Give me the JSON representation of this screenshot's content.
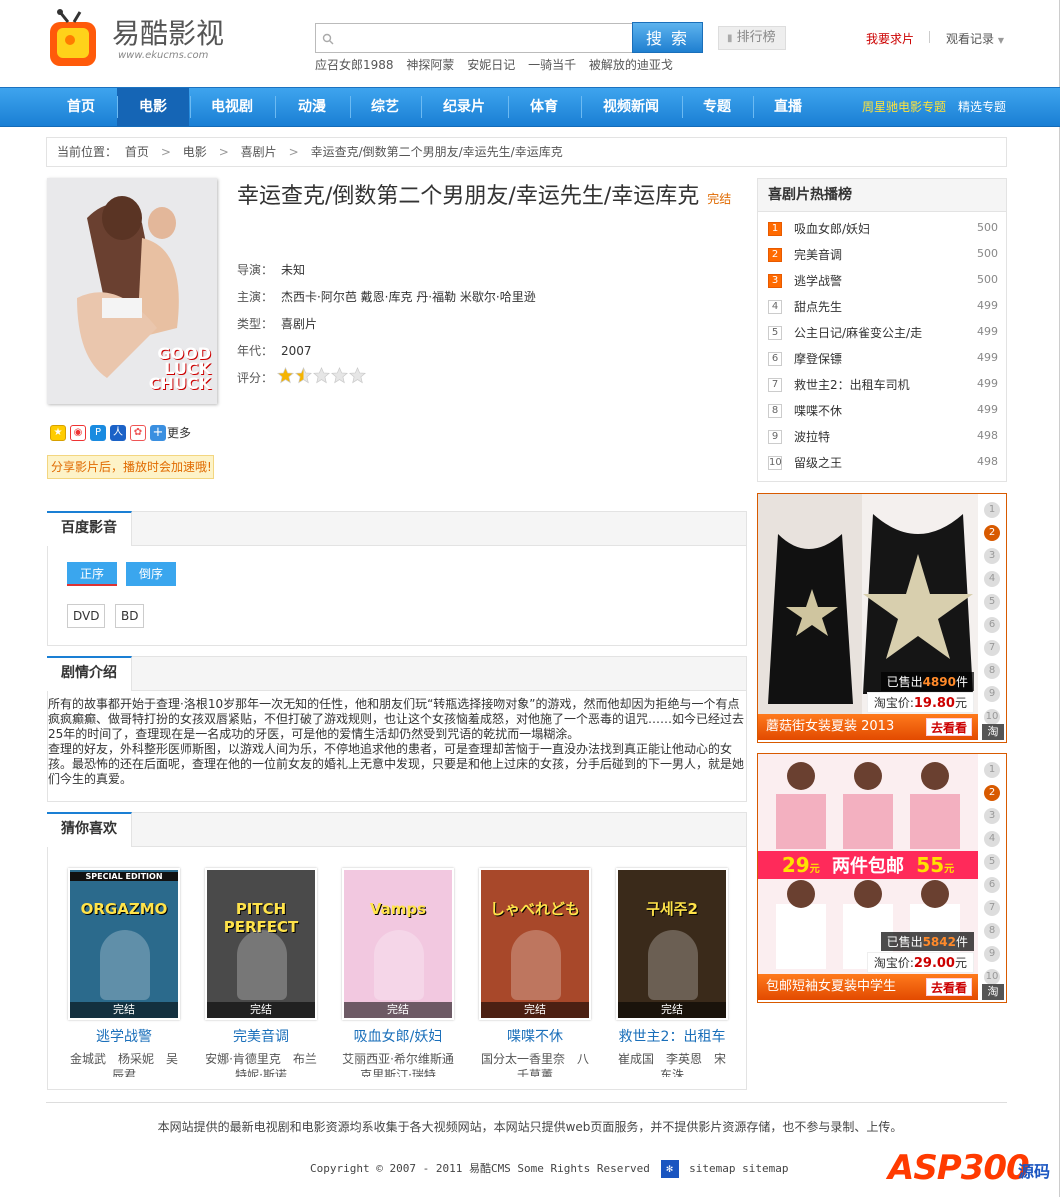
{
  "header": {
    "logo_text": "易酷影视",
    "logo_sub": "www.ekucms.com",
    "search_button": "搜 索",
    "rank_button": "排行榜",
    "request_link": "我要求片",
    "history_link": "观看记录",
    "hot_words": [
      "应召女郎1988",
      "神探阿蒙",
      "安妮日记",
      "一骑当千",
      "被解放的迪亚戈"
    ]
  },
  "nav": {
    "items": [
      "首页",
      "电影",
      "电视剧",
      "动漫",
      "综艺",
      "纪录片",
      "体育",
      "视频新闻",
      "专题",
      "直播"
    ],
    "active": "电影",
    "right_special": "周星驰电影专题",
    "right_pick": "精选专题"
  },
  "breadcrumb": {
    "label": "当前位置：",
    "items": [
      "首页",
      "电影",
      "喜剧片",
      "幸运查克/倒数第二个男朋友/幸运先生/幸运库克"
    ]
  },
  "movie": {
    "title": "幸运查克/倒数第二个男朋友/幸运先生/幸运库克",
    "status": "完结",
    "poster_title": "GOOD LUCK CHUCK",
    "director_label": "导演：",
    "director": "未知",
    "cast_label": "主演：",
    "cast": "杰西卡·阿尔芭 戴恩·库克 丹·福勒 米歇尔·哈里逊",
    "genre_label": "类型：",
    "genre": "喜剧片",
    "year_label": "年代：",
    "year": "2007",
    "rating_label": "评分：",
    "rating_stars": 1.5,
    "rating_max": 5,
    "share_more": "更多",
    "share_tip": "分享影片后，播放时会加速哦!"
  },
  "player": {
    "tab": "百度影音",
    "order_asc": "正序",
    "order_desc": "倒序",
    "episodes": [
      "DVD",
      "BD"
    ]
  },
  "plot": {
    "tab": "剧情介绍",
    "p1": "所有的故事都开始于查理·洛根10岁那年一次无知的任性，他和朋友们玩“转瓶选择接吻对象”的游戏，然而他却因为拒绝与一个有点疯疯癫癫、做哥特打扮的女孩双唇紧贴，不但打破了游戏规则，也让这个女孩恼羞成怒，对他施了一个恶毒的诅咒……如今已经过去25年的时间了，查理现在是一名成功的牙医，可是他的爱情生活却仍然受到咒语的乾扰而一塌糊涂。",
    "p2": "查理的好友，外科整形医师斯图，以游戏人间为乐，不停地追求他的患者，可是查理却苦恼于一直没办法找到真正能让他动心的女孩。最恐怖的还在后面呢，查理在他的一位前女友的婚礼上无意中发现，只要是和他上过床的女孩，分手后碰到的下一男人，就是她们今生的真爱。"
  },
  "guess": {
    "tab": "猜你喜欢",
    "items": [
      {
        "name": "逃学战警",
        "actors": "金城武　杨采妮　吴辰君",
        "status": "完结",
        "poster_text": "ORGAZMO",
        "top": "SPECIAL EDITION",
        "bg": "#2b6a8c"
      },
      {
        "name": "完美音调",
        "actors": "安娜·肯德里克　布兰特妮·斯诺",
        "status": "完结",
        "poster_text": "PITCH PERFECT",
        "top": "",
        "bg": "#4a4a4a"
      },
      {
        "name": "吸血女郎/妖妇",
        "actors": "艾丽西亚·希尔维斯通　克里斯汀·瑞特",
        "status": "完结",
        "poster_text": "Vamps",
        "top": "",
        "bg": "#f2c8e0"
      },
      {
        "name": "喋喋不休",
        "actors": "国分太一香里奈　八千草薰",
        "status": "完结",
        "poster_text": "しゃべれども",
        "top": "",
        "bg": "#a8482a"
      },
      {
        "name": "救世主2：出租车",
        "actors": "崔成国　李英恩　宋东洙",
        "status": "完结",
        "poster_text": "구세주2",
        "top": "",
        "bg": "#3a2a1a"
      }
    ]
  },
  "hot": {
    "title": "喜剧片热播榜",
    "items": [
      {
        "rank": "1",
        "name": "吸血女郎/妖妇",
        "score": "500"
      },
      {
        "rank": "2",
        "name": "完美音调",
        "score": "500"
      },
      {
        "rank": "3",
        "name": "逃学战警",
        "score": "500"
      },
      {
        "rank": "4",
        "name": "甜点先生",
        "score": "499"
      },
      {
        "rank": "5",
        "name": "公主日记/麻雀变公主/走",
        "score": "499"
      },
      {
        "rank": "6",
        "name": "摩登保镖",
        "score": "499"
      },
      {
        "rank": "7",
        "name": "救世主2：出租车司机",
        "score": "499"
      },
      {
        "rank": "8",
        "name": "喋喋不休",
        "score": "499"
      },
      {
        "rank": "9",
        "name": "波拉特",
        "score": "498"
      },
      {
        "rank": "10",
        "name": "留级之王",
        "score": "498"
      }
    ]
  },
  "ads": [
    {
      "bar": "蘑菇街女装夏装 2013",
      "go": "去看看",
      "sold_pre": "已售出",
      "sold": "4890",
      "sold_unit": "件",
      "price_pre": "淘宝价:",
      "price": "19.80",
      "price_unit": "元",
      "active": 2,
      "badge": "淘"
    },
    {
      "bar": "包邮短袖女夏装中学生",
      "go": "去看看",
      "sold_pre": "已售出",
      "sold": "5842",
      "sold_unit": "件",
      "price_pre": "淘宝价:",
      "price": "29.00",
      "price_unit": "元",
      "active": 2,
      "badge": "淘",
      "promo_left": "29",
      "promo_mid": "两件包邮",
      "promo_right": "55",
      "promo_unit": "元"
    }
  ],
  "ad_numbers": [
    "1",
    "2",
    "3",
    "4",
    "5",
    "6",
    "7",
    "8",
    "9",
    "10"
  ],
  "footer": {
    "notice": "本网站提供的最新电视剧和电影资源均系收集于各大视频网站，本网站只提供web页面服务，并不提供影片资源存储，也不参与录制、上传。",
    "copyright": "Copyright © 2007 - 2011 易酷CMS Some Rights Reserved",
    "sitemap": "sitemap sitemap"
  },
  "watermark": {
    "brand": "ASP300",
    "suffix": "源码"
  },
  "colors": {
    "nav_blue": "#1a7fd4",
    "accent_orange": "#e06a00",
    "ad_orange": "#d85a00"
  }
}
